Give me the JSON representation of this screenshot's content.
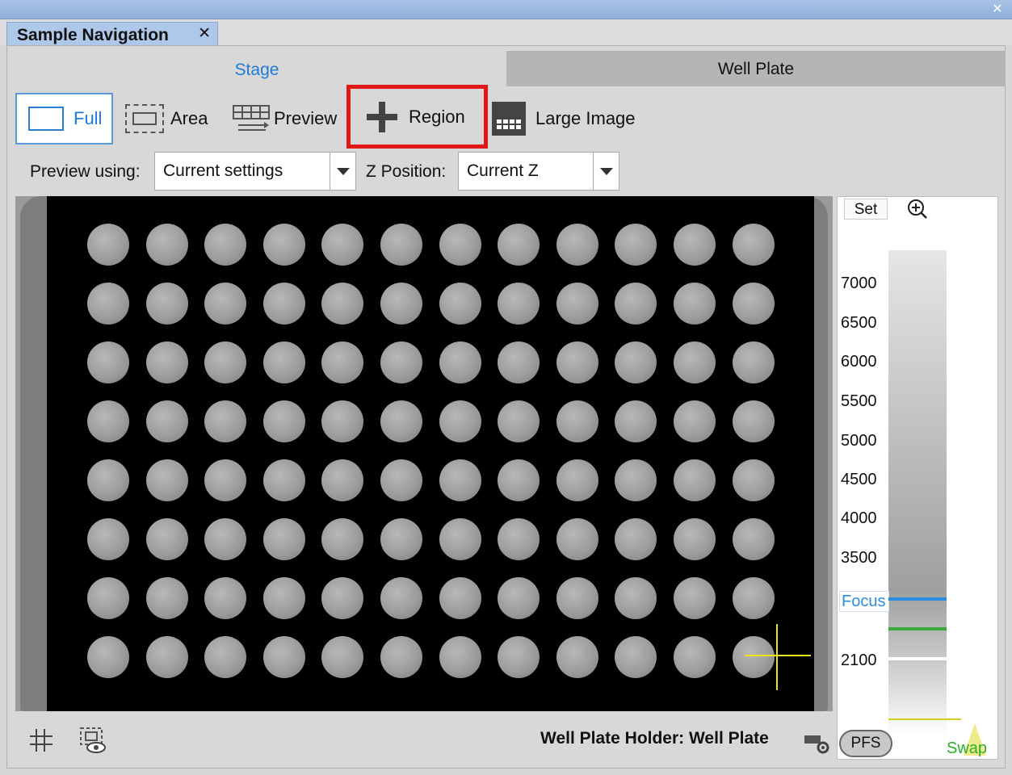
{
  "window": {
    "close_glyph": "✕"
  },
  "tab": {
    "title": "Sample Navigation",
    "close_glyph": "✕"
  },
  "segments": {
    "stage": "Stage",
    "well_plate": "Well Plate"
  },
  "modes": [
    {
      "id": "full",
      "label": "Full",
      "selected": true
    },
    {
      "id": "area",
      "label": "Area"
    },
    {
      "id": "preview",
      "label": "Preview"
    },
    {
      "id": "region",
      "label": "Region",
      "highlighted": true,
      "highlight_color": "#e01818"
    },
    {
      "id": "large-image",
      "label": "Large Image"
    }
  ],
  "preview_using": {
    "label": "Preview using:",
    "value": "Current settings"
  },
  "z_position": {
    "label": "Z Position:",
    "value": "Current Z"
  },
  "plate": {
    "rows": 8,
    "cols": 12,
    "current_well": {
      "row": 8,
      "col": 12
    },
    "crosshair_color": "#e6e61a"
  },
  "z_panel": {
    "set_label": "Set",
    "ticks": [
      "7000",
      "6500",
      "6000",
      "5500",
      "5000",
      "4500",
      "4000",
      "3500"
    ],
    "focus_label": "Focus",
    "low_tick": "2100",
    "pfs_label": "PFS",
    "swap_label": "Swap",
    "lines": {
      "focus": "#2a8de0",
      "green": "#3aa83a",
      "white": "#ffffff",
      "yellow": "#d0d020"
    }
  },
  "footer": {
    "holder_text": "Well Plate Holder: Well Plate"
  },
  "colors": {
    "accent": "#1f7bd6"
  }
}
